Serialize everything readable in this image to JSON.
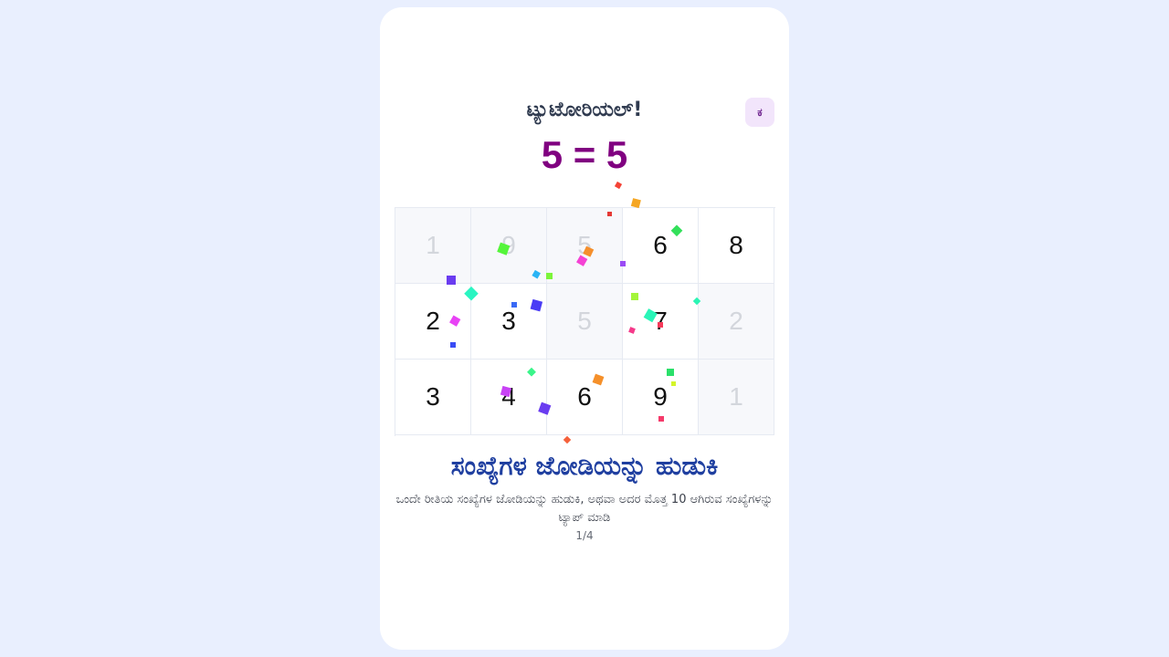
{
  "header": {
    "title": "ಟ್ಯುಟೋರಿಯಲ್!",
    "lang_button": "ಕ",
    "equation": "5 = 5"
  },
  "grid": {
    "rows": [
      [
        {
          "value": "1",
          "cleared": true
        },
        {
          "value": "9",
          "cleared": true
        },
        {
          "value": "5",
          "cleared": true
        },
        {
          "value": "6",
          "cleared": false
        },
        {
          "value": "8",
          "cleared": false
        }
      ],
      [
        {
          "value": "2",
          "cleared": false
        },
        {
          "value": "3",
          "cleared": false
        },
        {
          "value": "5",
          "cleared": true
        },
        {
          "value": "7",
          "cleared": false
        },
        {
          "value": "2",
          "cleared": true
        }
      ],
      [
        {
          "value": "3",
          "cleared": false
        },
        {
          "value": "4",
          "cleared": false
        },
        {
          "value": "6",
          "cleared": false
        },
        {
          "value": "9",
          "cleared": false
        },
        {
          "value": "1",
          "cleared": true
        }
      ]
    ]
  },
  "instructions": {
    "heading": "ಸಂಖ್ಯೆಗಳ ಜೋಡಿಯನ್ನು ಹುಡುಕಿ",
    "description": "ಒಂದೇ ರೀತಿಯ ಸಂಖ್ಯೆಗಳ ಜೋಡಿಯನ್ನು ಹುಡುಕಿ, ಅಥವಾ ಅದರ ಮೊತ್ತ 10 ಆಗಿರುವ ಸಂಖ್ಯೆಗಳನ್ನು ಟ್ಯಾಪ್ ಮಾಡಿ",
    "page_indicator": "1/4"
  },
  "colors": {
    "background": "#e9effe",
    "equation": "#800080",
    "heading": "#1f3fa0"
  }
}
